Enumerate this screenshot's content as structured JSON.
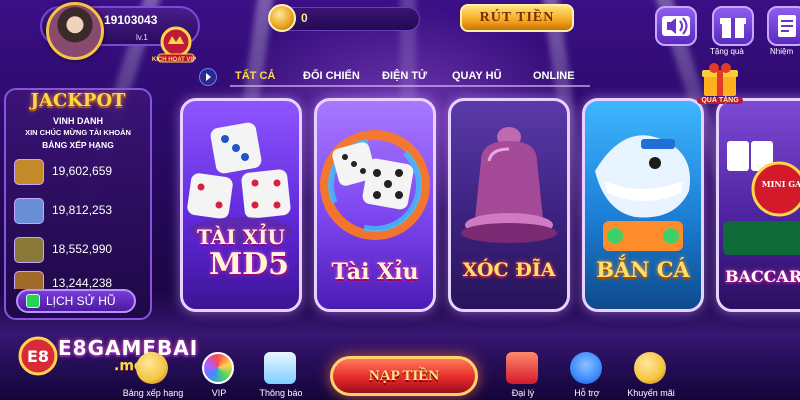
{
  "profile": {
    "user_id": "19103043",
    "level": "lv.1",
    "vip_badge": "KICH HOAT VIP"
  },
  "wallet": {
    "balance": "0"
  },
  "withdraw_label": "RÚT TIỀN",
  "top_actions": [
    {
      "name": "sound",
      "label": ""
    },
    {
      "name": "gift",
      "label": "Tặng quà"
    },
    {
      "name": "mission",
      "label": "Nhiệm"
    }
  ],
  "tabs": [
    {
      "label": "TẤT CẢ",
      "active": true
    },
    {
      "label": "ĐỐI CHIẾN",
      "active": false
    },
    {
      "label": "ĐIỆN TỬ",
      "active": false
    },
    {
      "label": "QUAY HŨ",
      "active": false
    },
    {
      "label": "ONLINE",
      "active": false
    }
  ],
  "jackpot": {
    "title": "JACKPOT",
    "subtitle": "VINH DANH",
    "line1": "XIN CHÚC MỪNG TÀI KHOẢN",
    "line2": "BẢNG XẾP HẠNG",
    "entries": [
      {
        "value": "19,602,659",
        "color": "#c48a2a"
      },
      {
        "value": "19,812,253",
        "color": "#6b8fd6"
      },
      {
        "value": "18,552,990",
        "color": "#8a7a3a"
      },
      {
        "value": "13,244,238",
        "color": "#a06a2a"
      }
    ],
    "history_label": "LỊCH SỬ HŨ"
  },
  "games": [
    {
      "title_top": "TÀI XỈU",
      "title_bottom": "MD5"
    },
    {
      "title": "Tài Xỉu"
    },
    {
      "title": "XÓC ĐĨA"
    },
    {
      "title": "BẮN CÁ"
    },
    {
      "title": "BACCARA",
      "badge": "MINI GAME"
    }
  ],
  "promo": {
    "label": "QUÀ TẶNG"
  },
  "logo": {
    "main": "E8GAMEBAI",
    "domain": ".mom"
  },
  "bottom_nav": [
    {
      "label": "Bảng xếp hạng",
      "color": "#f5c542"
    },
    {
      "label": "VIP",
      "color": "#ff7ad6"
    },
    {
      "label": "Thông báo",
      "color": "#7fd0ff"
    },
    {
      "label": "Đại lý",
      "color": "#ff5a5a"
    },
    {
      "label": "Hỗ trợ",
      "color": "#3b8cff"
    },
    {
      "label": "Khuyến mãi",
      "color": "#f5c542"
    }
  ],
  "topup_label": "NẠP TIỀN"
}
